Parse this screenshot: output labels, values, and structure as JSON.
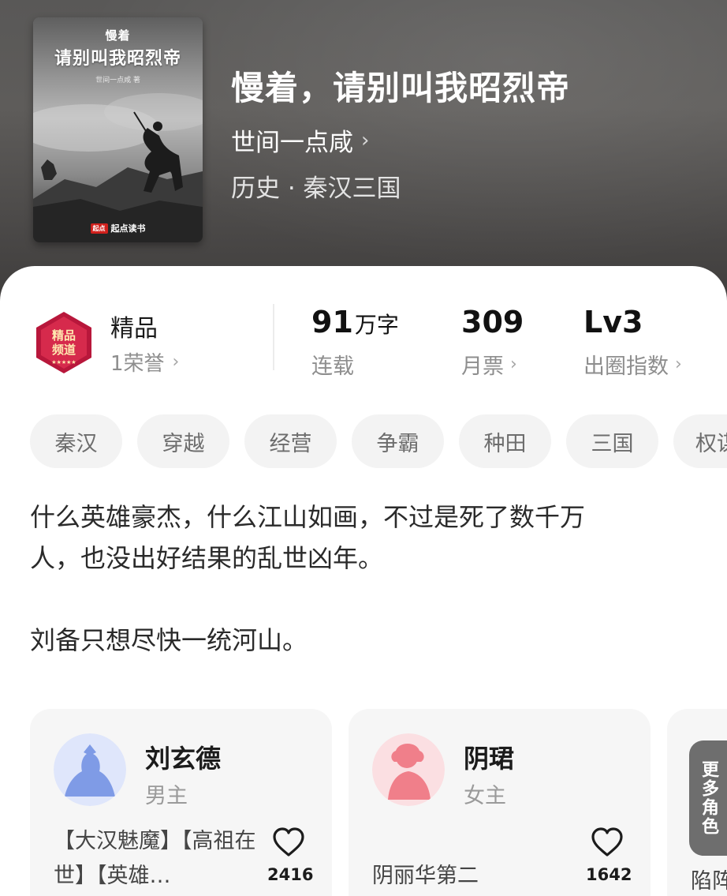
{
  "book": {
    "cover_small_title": "慢着",
    "cover_title": "请别叫我昭烈帝",
    "cover_author": "世间一点咸 著",
    "cover_brand_badge": "起点",
    "cover_brand": "起点读书",
    "title": "慢着，请别叫我昭烈帝",
    "author": "世间一点咸",
    "genre": "历史 · 秦汉三国"
  },
  "stats": {
    "badge_text": "精品频道",
    "grade": "精品",
    "honor": "1荣誉",
    "words_value": "91",
    "words_unit": "万字",
    "status": "连载",
    "monthly_votes": "309",
    "monthly_votes_label": "月票",
    "level": "Lv3",
    "level_label": "出圈指数"
  },
  "tags": [
    "秦汉",
    "穿越",
    "经营",
    "争霸",
    "种田",
    "三国",
    "权谋"
  ],
  "intro": {
    "line1": "什么英雄豪杰，什么江山如画，不过是死了数千万",
    "line2": "人，也没出好结果的乱世凶年。",
    "line3": "刘备只想尽快一统河山。"
  },
  "characters": [
    {
      "name": "刘玄德",
      "role": "男主",
      "tags": "【大汉魅魔】【高祖在世】【英雄…",
      "likes": "2416",
      "avatar_color": "#7f9be6"
    },
    {
      "name": "阴珺",
      "role": "女主",
      "tags": "阴丽华第二",
      "likes": "1642",
      "avatar_color": "#f07f8a"
    }
  ],
  "more_characters": {
    "label": "更多角色",
    "peek": "陷阵"
  },
  "colors": {
    "header_bg": "#595857",
    "card_bg": "#f6f6f6",
    "tag_bg": "#f3f3f3",
    "badge_red": "#b8173b"
  }
}
